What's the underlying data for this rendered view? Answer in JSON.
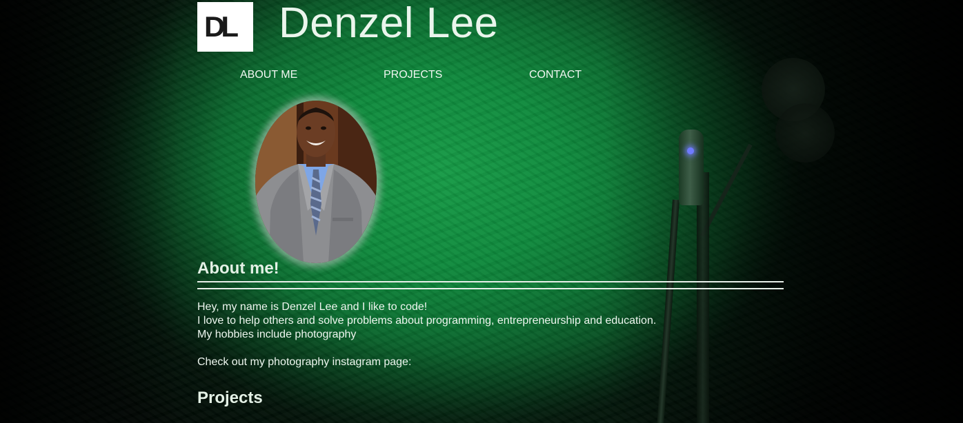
{
  "header": {
    "logo_text": "DL",
    "title": "Denzel Lee"
  },
  "nav": {
    "items": [
      {
        "label": "ABOUT ME"
      },
      {
        "label": "PROJECTS"
      },
      {
        "label": "CONTACT"
      }
    ]
  },
  "about": {
    "heading": "About me!",
    "lines": [
      "Hey, my name is Denzel Lee and I like to code!",
      "I love to help others and solve problems about programming, entrepreneurship and education.",
      "My hobbies include photography"
    ],
    "instagram_text": "Check out my photography instagram page:"
  },
  "projects": {
    "heading": "Projects"
  },
  "colors": {
    "background_green": "#0e8a3c",
    "text": "#eef6ef",
    "suit_gray": "#8a8a8c",
    "shirt_blue": "#7ea6e6"
  }
}
